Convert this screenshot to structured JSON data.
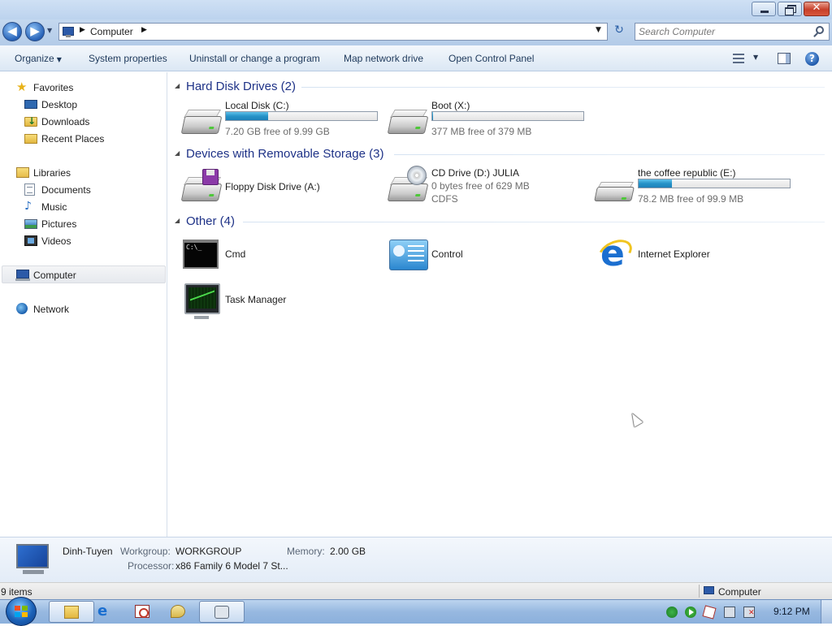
{
  "window": {
    "close_glyph": "✕"
  },
  "address": {
    "breadcrumb": [
      "Computer"
    ],
    "search_placeholder": "Search Computer"
  },
  "commandbar": {
    "organize": "Organize",
    "system_properties": "System properties",
    "uninstall": "Uninstall or change a program",
    "map_drive": "Map network drive",
    "control_panel": "Open Control Panel"
  },
  "sidebar": {
    "favorites": {
      "label": "Favorites",
      "icon": "star-icon",
      "items": [
        {
          "label": "Desktop",
          "icon": "desktop-icon"
        },
        {
          "label": "Downloads",
          "icon": "downloads-icon"
        },
        {
          "label": "Recent Places",
          "icon": "recent-places-icon"
        }
      ]
    },
    "libraries": {
      "label": "Libraries",
      "icon": "libraries-icon",
      "items": [
        {
          "label": "Documents",
          "icon": "documents-icon"
        },
        {
          "label": "Music",
          "icon": "music-icon"
        },
        {
          "label": "Pictures",
          "icon": "pictures-icon"
        },
        {
          "label": "Videos",
          "icon": "videos-icon"
        }
      ]
    },
    "computer": {
      "label": "Computer",
      "icon": "computer-icon",
      "selected": true
    },
    "network": {
      "label": "Network",
      "icon": "network-icon"
    }
  },
  "groups": {
    "hdd": {
      "title": "Hard Disk Drives (2)",
      "items": [
        {
          "name": "Local Disk (C:)",
          "free": "7.20 GB free of 9.99 GB",
          "used_fraction": 0.28
        },
        {
          "name": "Boot (X:)",
          "free": "377 MB free of 379 MB",
          "used_fraction": 0.005
        }
      ]
    },
    "removable": {
      "title": "Devices with Removable Storage (3)",
      "items": [
        {
          "name": "Floppy Disk Drive (A:)"
        },
        {
          "name": "CD Drive (D:) JULIA",
          "free": "0 bytes free of 629 MB",
          "fs": "CDFS"
        },
        {
          "name": "the coffee republic (E:)",
          "free": "78.2 MB free of 99.9 MB",
          "used_fraction": 0.22
        }
      ]
    },
    "other": {
      "title": "Other (4)",
      "items": [
        {
          "name": "Cmd"
        },
        {
          "name": "Control"
        },
        {
          "name": "Internet Explorer"
        },
        {
          "name": "Task Manager"
        }
      ]
    }
  },
  "details": {
    "computer_name": "Dinh-Tuyen",
    "workgroup_label": "Workgroup:",
    "workgroup": "WORKGROUP",
    "memory_label": "Memory:",
    "memory": "2.00 GB",
    "processor_label": "Processor:",
    "processor": "x86 Family 6 Model 7 St..."
  },
  "statusbar": {
    "count": "9 items",
    "location": "Computer"
  },
  "taskbar": {
    "clock": "9:12 PM"
  },
  "colors": {
    "group_header": "#1e3287",
    "usage_bar": "#2693c8",
    "titlebar": "#bcd3ee"
  }
}
